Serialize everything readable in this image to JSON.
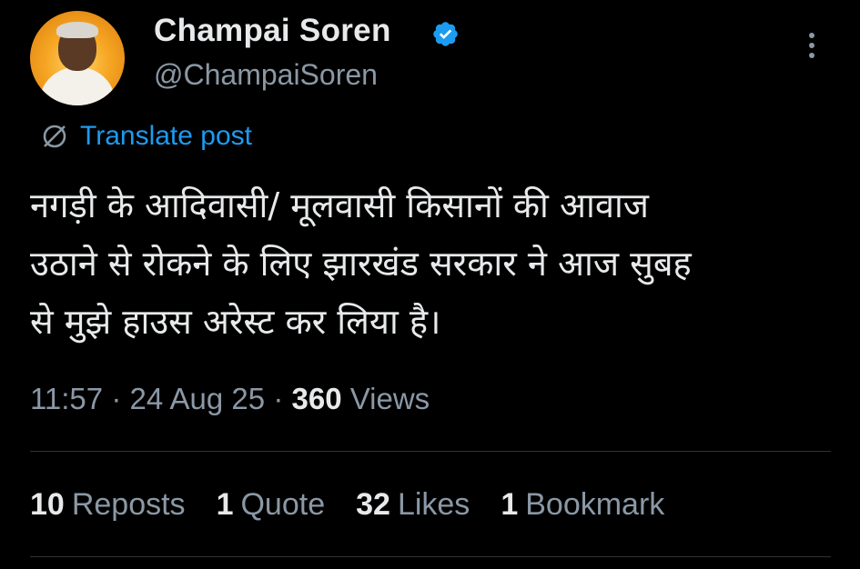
{
  "author": {
    "display_name": "Champai Soren",
    "handle": "@ChampaiSoren",
    "verified": true,
    "verified_color": "#1d9bf0"
  },
  "translate": {
    "label": "Translate post",
    "icon": "translate-globe-icon"
  },
  "post": {
    "text_lines": [
      "नगड़ी के आदिवासी/ मूलवासी किसानों की आवाज",
      "उठाने से रोकने के लिए झारखंड सरकार ने आज सुबह",
      "से मुझे हाउस अरेस्ट कर लिया है।"
    ]
  },
  "meta": {
    "time": "11:57",
    "separator": "·",
    "date": "24 Aug 25",
    "views_count": "360",
    "views_label": "Views"
  },
  "stats": [
    {
      "count": "10",
      "label": "Reposts"
    },
    {
      "count": "1",
      "label": "Quote"
    },
    {
      "count": "32",
      "label": "Likes"
    },
    {
      "count": "1",
      "label": "Bookmark"
    }
  ],
  "colors": {
    "background": "#000000",
    "primary_text": "#e7e9ea",
    "secondary_text": "#8b98a5",
    "accent": "#1d9bf0",
    "divider": "#2f3336"
  }
}
